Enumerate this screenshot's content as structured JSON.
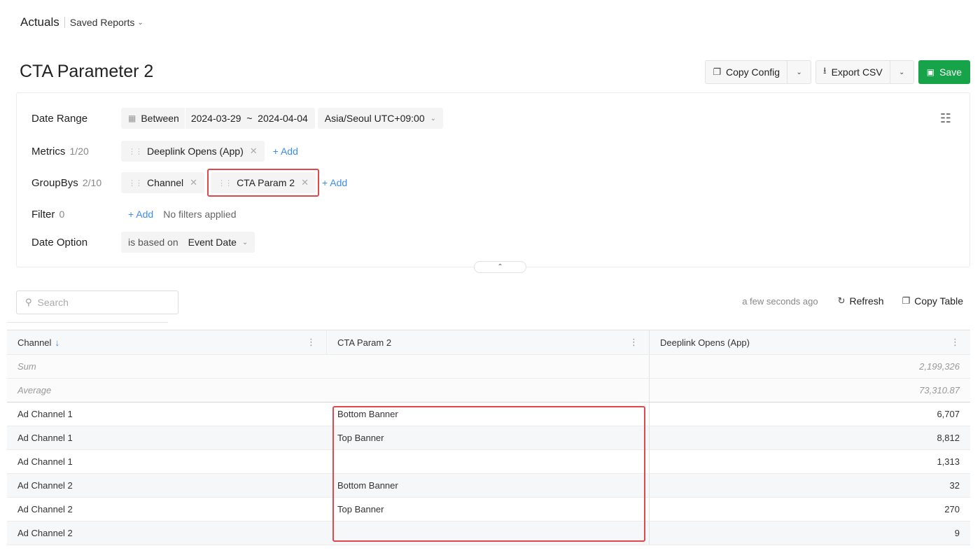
{
  "header": {
    "app_title": "Actuals",
    "saved_reports_label": "Saved Reports"
  },
  "page": {
    "title": "CTA Parameter 2"
  },
  "actions": {
    "copy_config_label": "Copy Config",
    "export_csv_label": "Export CSV",
    "save_label": "Save"
  },
  "config": {
    "date_range": {
      "label": "Date Range",
      "mode": "Between",
      "range": "2024-03-29  ~  2024-04-04",
      "timezone": "Asia/Seoul UTC+09:00"
    },
    "metrics": {
      "label": "Metrics",
      "count": "1/20",
      "items": [
        "Deeplink Opens (App)"
      ],
      "add_label": "+ Add"
    },
    "groupbys": {
      "label": "GroupBys",
      "count": "2/10",
      "items": [
        "Channel",
        "CTA Param 2"
      ],
      "add_label": "+ Add"
    },
    "filter": {
      "label": "Filter",
      "count": "0",
      "add_label": "+ Add",
      "empty_text": "No filters applied"
    },
    "date_option": {
      "label": "Date Option",
      "prefix": "is based on",
      "value": "Event Date"
    }
  },
  "toolbar": {
    "search_placeholder": "Search",
    "last_updated": "a few seconds ago",
    "refresh_label": "Refresh",
    "copy_table_label": "Copy Table"
  },
  "table": {
    "columns": [
      "Channel",
      "CTA Param 2",
      "Deeplink Opens (App)"
    ],
    "summary": [
      {
        "label": "Sum",
        "value": "2,199,326"
      },
      {
        "label": "Average",
        "value": "73,310.87"
      }
    ],
    "rows": [
      {
        "channel": "Ad Channel 1",
        "cta": "Bottom Banner",
        "value": "6,707"
      },
      {
        "channel": "Ad Channel 1",
        "cta": "Top Banner",
        "value": "8,812"
      },
      {
        "channel": "Ad Channel 1",
        "cta": "",
        "value": "1,313"
      },
      {
        "channel": "Ad Channel 2",
        "cta": "Bottom Banner",
        "value": "32"
      },
      {
        "channel": "Ad Channel 2",
        "cta": "Top Banner",
        "value": "270"
      },
      {
        "channel": "Ad Channel 2",
        "cta": "",
        "value": "9"
      }
    ]
  },
  "colors": {
    "accent_green": "#17a34a",
    "link_blue": "#3b8cf0",
    "highlight_red": "#e0484b"
  }
}
